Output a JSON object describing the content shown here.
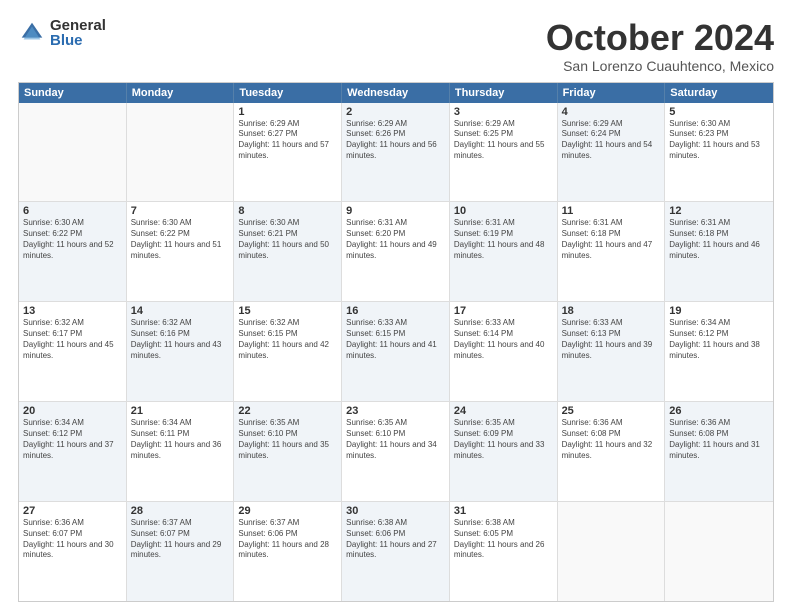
{
  "logo": {
    "general": "General",
    "blue": "Blue"
  },
  "title": "October 2024",
  "location": "San Lorenzo Cuauhtenco, Mexico",
  "header_days": [
    "Sunday",
    "Monday",
    "Tuesday",
    "Wednesday",
    "Thursday",
    "Friday",
    "Saturday"
  ],
  "weeks": [
    [
      {
        "day": "",
        "sunrise": "",
        "sunset": "",
        "daylight": "",
        "shaded": false,
        "empty": true
      },
      {
        "day": "",
        "sunrise": "",
        "sunset": "",
        "daylight": "",
        "shaded": true,
        "empty": true
      },
      {
        "day": "1",
        "sunrise": "Sunrise: 6:29 AM",
        "sunset": "Sunset: 6:27 PM",
        "daylight": "Daylight: 11 hours and 57 minutes.",
        "shaded": false
      },
      {
        "day": "2",
        "sunrise": "Sunrise: 6:29 AM",
        "sunset": "Sunset: 6:26 PM",
        "daylight": "Daylight: 11 hours and 56 minutes.",
        "shaded": true
      },
      {
        "day": "3",
        "sunrise": "Sunrise: 6:29 AM",
        "sunset": "Sunset: 6:25 PM",
        "daylight": "Daylight: 11 hours and 55 minutes.",
        "shaded": false
      },
      {
        "day": "4",
        "sunrise": "Sunrise: 6:29 AM",
        "sunset": "Sunset: 6:24 PM",
        "daylight": "Daylight: 11 hours and 54 minutes.",
        "shaded": true
      },
      {
        "day": "5",
        "sunrise": "Sunrise: 6:30 AM",
        "sunset": "Sunset: 6:23 PM",
        "daylight": "Daylight: 11 hours and 53 minutes.",
        "shaded": false
      }
    ],
    [
      {
        "day": "6",
        "sunrise": "Sunrise: 6:30 AM",
        "sunset": "Sunset: 6:22 PM",
        "daylight": "Daylight: 11 hours and 52 minutes.",
        "shaded": true
      },
      {
        "day": "7",
        "sunrise": "Sunrise: 6:30 AM",
        "sunset": "Sunset: 6:22 PM",
        "daylight": "Daylight: 11 hours and 51 minutes.",
        "shaded": false
      },
      {
        "day": "8",
        "sunrise": "Sunrise: 6:30 AM",
        "sunset": "Sunset: 6:21 PM",
        "daylight": "Daylight: 11 hours and 50 minutes.",
        "shaded": true
      },
      {
        "day": "9",
        "sunrise": "Sunrise: 6:31 AM",
        "sunset": "Sunset: 6:20 PM",
        "daylight": "Daylight: 11 hours and 49 minutes.",
        "shaded": false
      },
      {
        "day": "10",
        "sunrise": "Sunrise: 6:31 AM",
        "sunset": "Sunset: 6:19 PM",
        "daylight": "Daylight: 11 hours and 48 minutes.",
        "shaded": true
      },
      {
        "day": "11",
        "sunrise": "Sunrise: 6:31 AM",
        "sunset": "Sunset: 6:18 PM",
        "daylight": "Daylight: 11 hours and 47 minutes.",
        "shaded": false
      },
      {
        "day": "12",
        "sunrise": "Sunrise: 6:31 AM",
        "sunset": "Sunset: 6:18 PM",
        "daylight": "Daylight: 11 hours and 46 minutes.",
        "shaded": true
      }
    ],
    [
      {
        "day": "13",
        "sunrise": "Sunrise: 6:32 AM",
        "sunset": "Sunset: 6:17 PM",
        "daylight": "Daylight: 11 hours and 45 minutes.",
        "shaded": false
      },
      {
        "day": "14",
        "sunrise": "Sunrise: 6:32 AM",
        "sunset": "Sunset: 6:16 PM",
        "daylight": "Daylight: 11 hours and 43 minutes.",
        "shaded": true
      },
      {
        "day": "15",
        "sunrise": "Sunrise: 6:32 AM",
        "sunset": "Sunset: 6:15 PM",
        "daylight": "Daylight: 11 hours and 42 minutes.",
        "shaded": false
      },
      {
        "day": "16",
        "sunrise": "Sunrise: 6:33 AM",
        "sunset": "Sunset: 6:15 PM",
        "daylight": "Daylight: 11 hours and 41 minutes.",
        "shaded": true
      },
      {
        "day": "17",
        "sunrise": "Sunrise: 6:33 AM",
        "sunset": "Sunset: 6:14 PM",
        "daylight": "Daylight: 11 hours and 40 minutes.",
        "shaded": false
      },
      {
        "day": "18",
        "sunrise": "Sunrise: 6:33 AM",
        "sunset": "Sunset: 6:13 PM",
        "daylight": "Daylight: 11 hours and 39 minutes.",
        "shaded": true
      },
      {
        "day": "19",
        "sunrise": "Sunrise: 6:34 AM",
        "sunset": "Sunset: 6:12 PM",
        "daylight": "Daylight: 11 hours and 38 minutes.",
        "shaded": false
      }
    ],
    [
      {
        "day": "20",
        "sunrise": "Sunrise: 6:34 AM",
        "sunset": "Sunset: 6:12 PM",
        "daylight": "Daylight: 11 hours and 37 minutes.",
        "shaded": true
      },
      {
        "day": "21",
        "sunrise": "Sunrise: 6:34 AM",
        "sunset": "Sunset: 6:11 PM",
        "daylight": "Daylight: 11 hours and 36 minutes.",
        "shaded": false
      },
      {
        "day": "22",
        "sunrise": "Sunrise: 6:35 AM",
        "sunset": "Sunset: 6:10 PM",
        "daylight": "Daylight: 11 hours and 35 minutes.",
        "shaded": true
      },
      {
        "day": "23",
        "sunrise": "Sunrise: 6:35 AM",
        "sunset": "Sunset: 6:10 PM",
        "daylight": "Daylight: 11 hours and 34 minutes.",
        "shaded": false
      },
      {
        "day": "24",
        "sunrise": "Sunrise: 6:35 AM",
        "sunset": "Sunset: 6:09 PM",
        "daylight": "Daylight: 11 hours and 33 minutes.",
        "shaded": true
      },
      {
        "day": "25",
        "sunrise": "Sunrise: 6:36 AM",
        "sunset": "Sunset: 6:08 PM",
        "daylight": "Daylight: 11 hours and 32 minutes.",
        "shaded": false
      },
      {
        "day": "26",
        "sunrise": "Sunrise: 6:36 AM",
        "sunset": "Sunset: 6:08 PM",
        "daylight": "Daylight: 11 hours and 31 minutes.",
        "shaded": true
      }
    ],
    [
      {
        "day": "27",
        "sunrise": "Sunrise: 6:36 AM",
        "sunset": "Sunset: 6:07 PM",
        "daylight": "Daylight: 11 hours and 30 minutes.",
        "shaded": false
      },
      {
        "day": "28",
        "sunrise": "Sunrise: 6:37 AM",
        "sunset": "Sunset: 6:07 PM",
        "daylight": "Daylight: 11 hours and 29 minutes.",
        "shaded": true
      },
      {
        "day": "29",
        "sunrise": "Sunrise: 6:37 AM",
        "sunset": "Sunset: 6:06 PM",
        "daylight": "Daylight: 11 hours and 28 minutes.",
        "shaded": false
      },
      {
        "day": "30",
        "sunrise": "Sunrise: 6:38 AM",
        "sunset": "Sunset: 6:06 PM",
        "daylight": "Daylight: 11 hours and 27 minutes.",
        "shaded": true
      },
      {
        "day": "31",
        "sunrise": "Sunrise: 6:38 AM",
        "sunset": "Sunset: 6:05 PM",
        "daylight": "Daylight: 11 hours and 26 minutes.",
        "shaded": false
      },
      {
        "day": "",
        "sunrise": "",
        "sunset": "",
        "daylight": "",
        "shaded": true,
        "empty": true
      },
      {
        "day": "",
        "sunrise": "",
        "sunset": "",
        "daylight": "",
        "shaded": false,
        "empty": true
      }
    ]
  ]
}
